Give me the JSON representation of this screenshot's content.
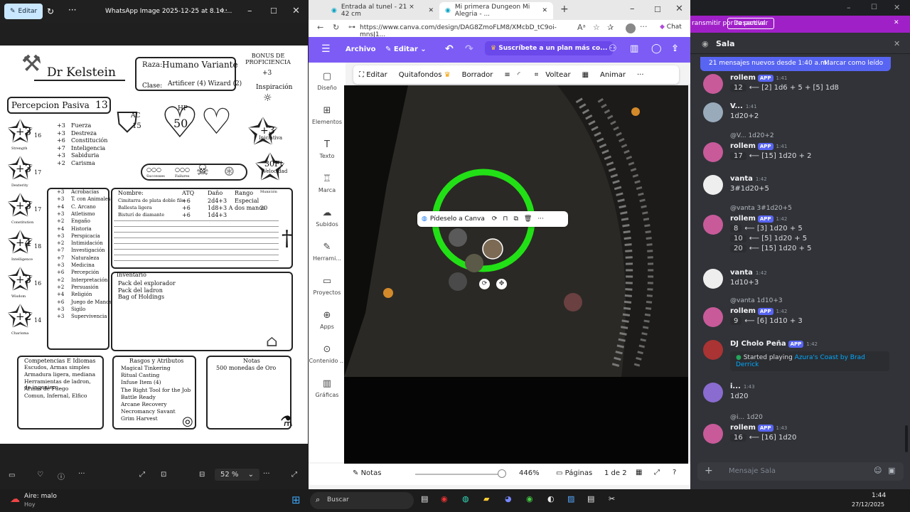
{
  "photos": {
    "edit_label": "Editar",
    "title": "WhatsApp Image 2025-12-25 at 8.14....",
    "zoom": "52 %"
  },
  "sheet": {
    "name": "Dr Kelstein",
    "race_label": "Raza:",
    "race": "Humano Variante",
    "class_label": "Clase:",
    "class": "Artificer (4) Wizard (2)",
    "prof_bonus": "BONUS DE PROFICIENCIA",
    "prof_value": "+3",
    "inspiration": "Inspiración",
    "passive": "Percepcion Pasiva",
    "passive_value": "13",
    "ac_label": "AC",
    "ac": "15",
    "hp_label": "HP",
    "hp": "50",
    "initiative": "+3",
    "initiative_label": "Iniciativa",
    "speed": "30Ft",
    "speed_label": "Velocidad",
    "successes": "Successes",
    "failures": "Failures",
    "abilities": [
      {
        "mod": "+3",
        "score": "16",
        "name": "Strength"
      },
      {
        "mod": "+3",
        "score": "17",
        "name": "Dexterity"
      },
      {
        "mod": "+3",
        "score": "17",
        "name": "Constitution"
      },
      {
        "mod": "+4",
        "score": "18",
        "name": "Intelligence"
      },
      {
        "mod": "+3",
        "score": "16",
        "name": "Wisdom"
      },
      {
        "mod": "+2",
        "score": "14",
        "name": "Charisma"
      }
    ],
    "saves": [
      [
        "+3",
        "Fuerza"
      ],
      [
        "+3",
        "Destreza"
      ],
      [
        "+6",
        "Constitución"
      ],
      [
        "+7",
        "Inteligencia"
      ],
      [
        "+3",
        "Sabiduria"
      ],
      [
        "+2",
        "Carisma"
      ]
    ],
    "skills": [
      [
        "+3",
        "Acrobacias"
      ],
      [
        "+3",
        "T. con Animales"
      ],
      [
        "+4",
        "C. Arcano"
      ],
      [
        "+3",
        "Atletismo"
      ],
      [
        "+2",
        "Engaño"
      ],
      [
        "+4",
        "Historia"
      ],
      [
        "+3",
        "Perspicacia"
      ],
      [
        "+2",
        "Intimidación"
      ],
      [
        "+7",
        "Investigación"
      ],
      [
        "+7",
        "Naturaleza"
      ],
      [
        "+3",
        "Medicina"
      ],
      [
        "+6",
        "Percepción"
      ],
      [
        "+2",
        "Interpretación"
      ],
      [
        "+2",
        "Persuasión"
      ],
      [
        "+4",
        "Religión"
      ],
      [
        "+6",
        "Juego de Manos"
      ],
      [
        "+3",
        "Sigilo"
      ],
      [
        "+3",
        "Supervivencia"
      ]
    ],
    "weapons_headers": [
      "Nombre:",
      "ATQ",
      "Daño",
      "Rango",
      "Munición"
    ],
    "weapons": [
      [
        "Cimitarra de plata doble filo",
        "+6",
        "2d4+3",
        "Especial",
        ""
      ],
      [
        "Ballesta ligera",
        "+6",
        "1d8+3 A",
        "dos manos",
        "20"
      ],
      [
        "Bisturí de diamante",
        "+6",
        "1d4+3",
        "",
        ""
      ]
    ],
    "inventory_title": "Inventario",
    "inventory": [
      "Pack del explorador",
      "Pack del ladron",
      "Bag of Holdings"
    ],
    "prof_title": "Competencias E Idiomas",
    "prof_items": [
      "Escudos, Armas simples",
      "Armadura ligera, mediana",
      "Herramientas de ladron, de ingeniero",
      "Armas de Fuego",
      "Comun, Infernal, Elfico"
    ],
    "traits_title": "Rasgos y Atributos",
    "traits": [
      "Magical Tinkering",
      "Ritual Casting",
      "Infuse Item (4)",
      "The Right Tool for the Job",
      "Battle Ready",
      "Arcane Recovery",
      "Necromancy Savant",
      "Grim Harvest"
    ],
    "notes_title": "Notas",
    "notes": [
      "500 monedas de Oro"
    ]
  },
  "edge": {
    "tab1": "Entrada al tunel - 21 × 42 cm",
    "tab2": "Mi primera Dungeon Mi Alegria - ...",
    "url": "https://www.canva.com/design/DAG8ZmoFLM8/XMcbD_tC9oi-mnsJ1...",
    "chat": "Chat"
  },
  "canva": {
    "archivo": "Archivo",
    "editar": "Editar",
    "subscribe": "Suscríbete a un plan más co...",
    "rail": [
      "Diseño",
      "Elementos",
      "Texto",
      "Marca",
      "Subidos",
      "Herrami...",
      "Proyectos",
      "Apps",
      "Contenido ...",
      "Gráficas"
    ],
    "toolbar": [
      "Editar",
      "Quitafondos",
      "Borrador",
      "Voltear",
      "Animar"
    ],
    "ask": "Pídeselo a Canva",
    "notes": "Notas",
    "zoom": "446%",
    "pages": "Páginas",
    "page_count": "1 de 2"
  },
  "discord": {
    "notice_text": "ransmitir por ra parcial.",
    "notice_btn": "Desactivar",
    "channel": "Sala",
    "banner": "21 mensajes nuevos desde 1:40 a.m.",
    "banner_action": "Marcar como leído",
    "messages": [
      {
        "name": "rollem",
        "app": "APP",
        "time": "1:41",
        "lines": [
          [
            "12",
            "⟵ [2] 1d6 + 5 + [5] 1d8"
          ]
        ]
      },
      {
        "name": "V...",
        "time": "1:41",
        "text": "1d20+2"
      },
      {
        "reply": "@V... 1d20+2",
        "name": "rollem",
        "app": "APP",
        "time": "1:41",
        "lines": [
          [
            "17",
            "⟵ [15] 1d20 + 2"
          ]
        ]
      },
      {
        "name": "vanta",
        "time": "1:42",
        "text": "3#1d20+5"
      },
      {
        "reply": "@vanta 3#1d20+5",
        "name": "rollem",
        "app": "APP",
        "time": "1:42",
        "lines": [
          [
            "8",
            "⟵ [3] 1d20 + 5"
          ],
          [
            "10",
            "⟵ [5] 1d20 + 5"
          ],
          [
            "20",
            "⟵ [15] 1d20 + 5"
          ]
        ]
      },
      {
        "name": "vanta",
        "time": "1:42",
        "text": "1d10+3"
      },
      {
        "reply": "@vanta 1d10+3",
        "name": "rollem",
        "app": "APP",
        "time": "1:42",
        "lines": [
          [
            "9",
            "⟵ [6] 1d10 + 3"
          ]
        ]
      },
      {
        "name": "DJ Cholo Peña",
        "app": "APP",
        "time": "1:42",
        "activity": "Started playing",
        "song": "Azura's Coast by Brad Derrick"
      },
      {
        "name": "i...",
        "time": "1:43",
        "text": "1d20"
      },
      {
        "reply": "@i... 1d20",
        "name": "rollem",
        "app": "APP",
        "time": "1:43",
        "lines": [
          [
            "16",
            "⟵ [16] 1d20"
          ]
        ]
      }
    ],
    "input_placeholder": "Mensaje Sala"
  },
  "taskbar": {
    "weather": "Aire: malo",
    "weather_sub": "Hoy",
    "search": "Buscar",
    "time": "1:44",
    "date": "27/12/2025"
  }
}
